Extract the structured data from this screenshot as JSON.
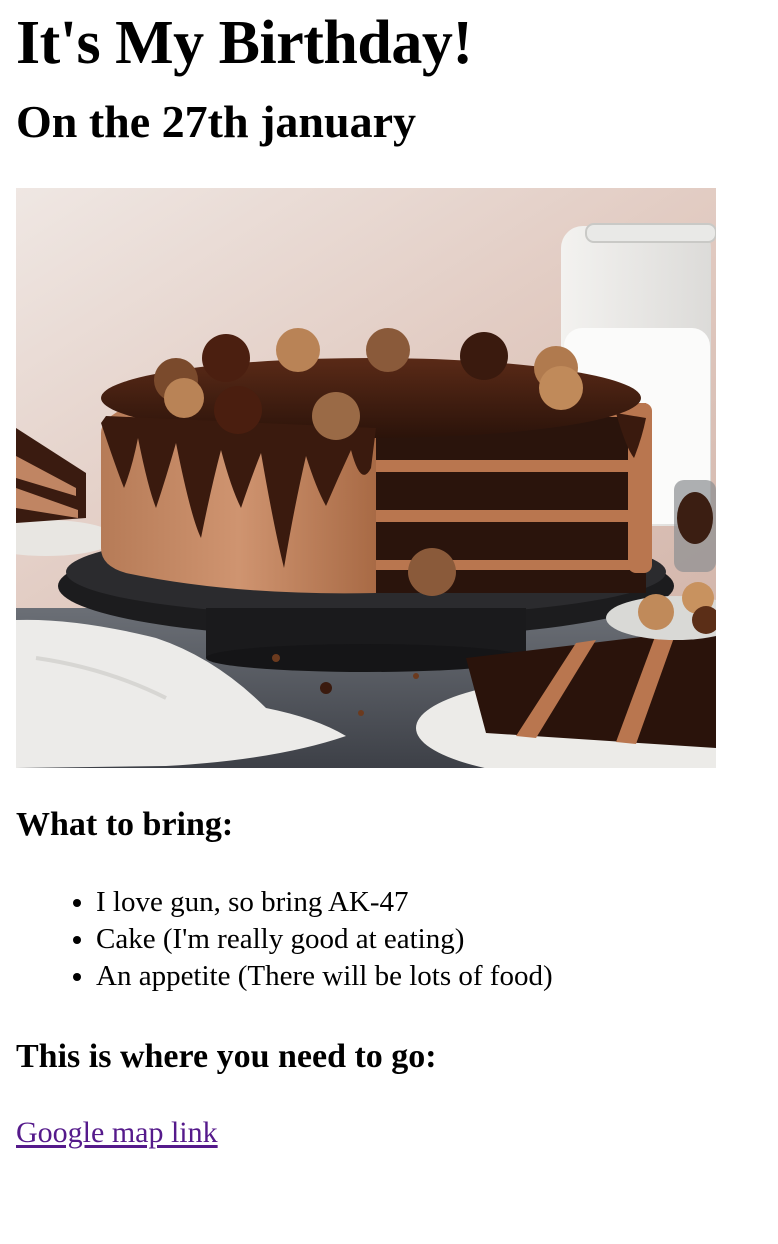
{
  "page": {
    "title": "It's My Birthday!",
    "date_heading": "On the 27th january"
  },
  "bring": {
    "heading": "What to bring:",
    "items": [
      "I love gun, so bring AK-47",
      "Cake (I'm really good at eating)",
      "An appetite (There will be lots of food)"
    ]
  },
  "location": {
    "heading": "This is where you need to go:",
    "link_label": "Google map link"
  },
  "colors": {
    "link_visited": "#551a8b",
    "text": "#000000",
    "background": "#ffffff"
  },
  "image": {
    "subject": "chocolate-layer-cake-photo"
  }
}
